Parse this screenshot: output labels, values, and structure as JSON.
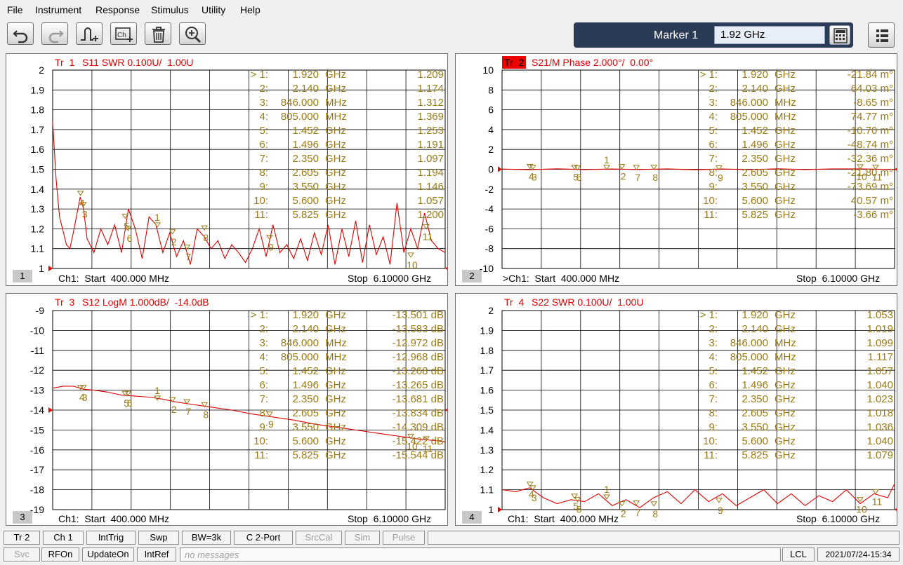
{
  "menu": [
    "File",
    "Instrument",
    "Response",
    "Stimulus",
    "Utility",
    "Help"
  ],
  "toolbar": {
    "buttons": [
      "undo-icon",
      "redo-icon",
      "add-marker-icon",
      "add-channel-icon",
      "delete-icon",
      "zoom-icon"
    ],
    "marker_label": "Marker 1",
    "marker_value": "1.92 GHz"
  },
  "colors": {
    "trace": "#e00000",
    "marker": "#9a7b18",
    "accent": "#2b3a55",
    "active_trace_box": "#ee0000"
  },
  "marker_freqs": {
    "values": [
      "1.920",
      "2.140",
      "846.000",
      "805.000",
      "1.452",
      "1.496",
      "2.350",
      "2.605",
      "3.550",
      "5.600",
      "5.825"
    ],
    "units": [
      "GHz",
      "GHz",
      "MHz",
      "MHz",
      "GHz",
      "GHz",
      "GHz",
      "GHz",
      "GHz",
      "GHz",
      "GHz"
    ]
  },
  "panels": [
    {
      "num": "1",
      "tr_label": "Tr  1",
      "title": "S11 SWR 0.100U/  1.00U",
      "footer_left": "Ch1:  Start  400.000 MHz",
      "footer_right": "Stop  6.10000 GHz",
      "marker_values": [
        "1.209",
        "1.174",
        "1.312",
        "1.369",
        "1.253",
        "1.191",
        "1.097",
        "1.194",
        "1.146",
        "1.057",
        "1.200"
      ],
      "chart_data": {
        "type": "line",
        "xlim": [
          0.4,
          6.1
        ],
        "ylim": [
          1.0,
          2.0
        ],
        "y_ticks": [
          "2",
          "1.9",
          "1.8",
          "1.7",
          "1.6",
          "1.5",
          "1.4",
          "1.3",
          "1.2",
          "1.1",
          "1"
        ],
        "series": [
          {
            "x": [
              0.4,
              0.45,
              0.5,
              0.6,
              0.65,
              0.7,
              0.8,
              0.85,
              0.9,
              1.0,
              1.1,
              1.2,
              1.3,
              1.4,
              1.5,
              1.6,
              1.7,
              1.8,
              1.9,
              2.0,
              2.1,
              2.2,
              2.3,
              2.4,
              2.5,
              2.6,
              2.7,
              2.8,
              2.9,
              3.0,
              3.1,
              3.2,
              3.3,
              3.4,
              3.5,
              3.6,
              3.7,
              3.8,
              3.9,
              4.0,
              4.1,
              4.2,
              4.3,
              4.4,
              4.5,
              4.6,
              4.7,
              4.8,
              4.9,
              5.0,
              5.1,
              5.2,
              5.3,
              5.4,
              5.5,
              5.6,
              5.7,
              5.8,
              5.9,
              6.0,
              6.1
            ],
            "y": [
              1.74,
              1.45,
              1.26,
              1.12,
              1.1,
              1.18,
              1.36,
              1.3,
              1.15,
              1.08,
              1.2,
              1.12,
              1.22,
              1.08,
              1.3,
              1.2,
              1.05,
              1.26,
              1.22,
              1.08,
              1.18,
              1.06,
              1.14,
              1.02,
              1.2,
              1.16,
              1.1,
              1.14,
              1.05,
              1.12,
              1.08,
              1.03,
              1.1,
              1.2,
              1.06,
              1.22,
              1.08,
              1.12,
              1.05,
              1.15,
              1.04,
              1.18,
              1.07,
              1.22,
              1.02,
              1.2,
              1.06,
              1.24,
              1.03,
              1.22,
              1.07,
              1.16,
              1.02,
              1.33,
              1.08,
              1.2,
              1.1,
              1.28,
              1.14,
              1.1,
              1.08
            ]
          }
        ]
      },
      "markers": [
        {
          "id": "1",
          "x": 1.92,
          "y": 1.209
        },
        {
          "id": "2",
          "x": 2.14,
          "y": 1.174
        },
        {
          "id": "3",
          "x": 0.846,
          "y": 1.312
        },
        {
          "id": "4",
          "x": 0.805,
          "y": 1.369
        },
        {
          "id": "5",
          "x": 1.452,
          "y": 1.253
        },
        {
          "id": "6",
          "x": 1.496,
          "y": 1.191
        },
        {
          "id": "7",
          "x": 2.35,
          "y": 1.097
        },
        {
          "id": "8",
          "x": 2.605,
          "y": 1.194
        },
        {
          "id": "9",
          "x": 3.55,
          "y": 1.146
        },
        {
          "id": "10",
          "x": 5.6,
          "y": 1.057
        },
        {
          "id": "11",
          "x": 5.825,
          "y": 1.2
        }
      ]
    },
    {
      "num": "2",
      "tr_label": "Tr  2",
      "title": "S21/M Phase 2.000°/  0.00°",
      "footer_left": ">Ch1:  Start  400.000 MHz",
      "footer_right": "Stop  6.10000 GHz",
      "marker_values": [
        "-21.84 m°",
        "64.03 m°",
        "-8.65 m°",
        "74.77 m°",
        "-10.70 m°",
        "-48.74 m°",
        "-32.36 m°",
        "-21.80 m°",
        "-73.69 m°",
        "40.57 m°",
        "-3.66 m°"
      ],
      "chart_data": {
        "type": "line",
        "xlim": [
          0.4,
          6.1
        ],
        "ylim": [
          -10,
          10
        ],
        "y_ticks": [
          "10",
          "8",
          "6",
          "4",
          "2",
          "0",
          "-2",
          "-4",
          "-6",
          "-8",
          "-10"
        ],
        "series": [
          {
            "x": [
              0.4,
              0.8,
              1.2,
              1.6,
              2.0,
              2.4,
              2.8,
              3.2,
              3.6,
              4.0,
              4.4,
              4.8,
              5.2,
              5.6,
              6.1
            ],
            "y": [
              0.02,
              -0.04,
              0.05,
              -0.03,
              0.03,
              -0.02,
              0.04,
              -0.05,
              0.03,
              -0.04,
              0.05,
              -0.03,
              0.04,
              0.04,
              -0.02
            ]
          }
        ]
      },
      "markers": [
        {
          "id": "1",
          "x": 1.92,
          "y": -0.02
        },
        {
          "id": "2",
          "x": 2.14,
          "y": 0.06
        },
        {
          "id": "3",
          "x": 0.846,
          "y": -0.01
        },
        {
          "id": "4",
          "x": 0.805,
          "y": 0.07
        },
        {
          "id": "5",
          "x": 1.452,
          "y": -0.01
        },
        {
          "id": "6",
          "x": 1.496,
          "y": -0.05
        },
        {
          "id": "7",
          "x": 2.35,
          "y": -0.03
        },
        {
          "id": "8",
          "x": 2.605,
          "y": -0.02
        },
        {
          "id": "9",
          "x": 3.55,
          "y": -0.07
        },
        {
          "id": "10",
          "x": 5.6,
          "y": 0.04
        },
        {
          "id": "11",
          "x": 5.825,
          "y": 0.0
        }
      ]
    },
    {
      "num": "3",
      "tr_label": "Tr  3",
      "title": "S12 LogM 1.000dB/  -14.0dB",
      "footer_left": "Ch1:  Start  400.000 MHz",
      "footer_right": "Stop  6.10000 GHz",
      "marker_values": [
        "-13.501 dB",
        "-13.583 dB",
        "-12.972 dB",
        "-12.968 dB",
        "-13.268 dB",
        "-13.265 dB",
        "-13.681 dB",
        "-13.834 dB",
        "-14.309 dB",
        "-15.422 dB",
        "-15.544 dB"
      ],
      "chart_data": {
        "type": "line",
        "xlim": [
          0.4,
          6.1
        ],
        "ylim": [
          -19,
          -9
        ],
        "y_ticks": [
          "-9",
          "-10",
          "-11",
          "-12",
          "-13",
          "-14",
          "-15",
          "-16",
          "-17",
          "-18",
          "-19"
        ],
        "series": [
          {
            "x": [
              0.4,
              0.55,
              0.7,
              0.85,
              1.0,
              1.2,
              1.4,
              1.6,
              1.8,
              2.0,
              2.2,
              2.4,
              2.6,
              2.8,
              3.0,
              3.3,
              3.6,
              3.9,
              4.2,
              4.5,
              4.8,
              5.1,
              5.4,
              5.7,
              6.0,
              6.1
            ],
            "y": [
              -12.9,
              -12.8,
              -12.8,
              -12.95,
              -13.0,
              -13.1,
              -13.25,
              -13.3,
              -13.35,
              -13.45,
              -13.6,
              -13.7,
              -13.8,
              -13.9,
              -14.0,
              -14.2,
              -14.35,
              -14.5,
              -14.7,
              -14.85,
              -15.0,
              -15.15,
              -15.3,
              -15.45,
              -15.55,
              -15.6
            ]
          }
        ]
      },
      "markers": [
        {
          "id": "1",
          "x": 1.92,
          "y": -13.501
        },
        {
          "id": "2",
          "x": 2.14,
          "y": -13.583
        },
        {
          "id": "3",
          "x": 0.846,
          "y": -12.972
        },
        {
          "id": "4",
          "x": 0.805,
          "y": -12.968
        },
        {
          "id": "5",
          "x": 1.452,
          "y": -13.268
        },
        {
          "id": "6",
          "x": 1.496,
          "y": -13.265
        },
        {
          "id": "7",
          "x": 2.35,
          "y": -13.681
        },
        {
          "id": "8",
          "x": 2.605,
          "y": -13.834
        },
        {
          "id": "9",
          "x": 3.55,
          "y": -14.309
        },
        {
          "id": "10",
          "x": 5.6,
          "y": -15.422
        },
        {
          "id": "11",
          "x": 5.825,
          "y": -15.544
        }
      ]
    },
    {
      "num": "4",
      "tr_label": "Tr  4",
      "title": "S22 SWR 0.100U/  1.00U",
      "footer_left": "Ch1:  Start  400.000 MHz",
      "footer_right": "Stop  6.10000 GHz",
      "marker_values": [
        "1.053",
        "1.019",
        "1.099",
        "1.117",
        "1.057",
        "1.040",
        "1.023",
        "1.018",
        "1.036",
        "1.040",
        "1.079"
      ],
      "chart_data": {
        "type": "line",
        "xlim": [
          0.4,
          6.1
        ],
        "ylim": [
          1.0,
          2.0
        ],
        "y_ticks": [
          "2",
          "1.9",
          "1.8",
          "1.7",
          "1.6",
          "1.5",
          "1.4",
          "1.3",
          "1.2",
          "1.1",
          "1"
        ],
        "series": [
          {
            "x": [
              0.4,
              0.6,
              0.8,
              1.0,
              1.2,
              1.4,
              1.6,
              1.8,
              2.0,
              2.2,
              2.4,
              2.6,
              2.8,
              3.0,
              3.2,
              3.4,
              3.6,
              3.8,
              4.0,
              4.2,
              4.4,
              4.6,
              4.8,
              5.0,
              5.2,
              5.4,
              5.6,
              5.8,
              6.0,
              6.1
            ],
            "y": [
              1.1,
              1.09,
              1.11,
              1.06,
              1.03,
              1.05,
              1.04,
              1.08,
              1.02,
              1.05,
              1.01,
              1.06,
              1.09,
              1.03,
              1.1,
              1.04,
              1.08,
              1.02,
              1.06,
              1.1,
              1.03,
              1.08,
              1.02,
              1.07,
              1.04,
              1.1,
              1.03,
              1.08,
              1.06,
              1.13
            ]
          }
        ]
      },
      "markers": [
        {
          "id": "1",
          "x": 1.92,
          "y": 1.053
        },
        {
          "id": "2",
          "x": 2.14,
          "y": 1.019
        },
        {
          "id": "3",
          "x": 0.846,
          "y": 1.099
        },
        {
          "id": "4",
          "x": 0.805,
          "y": 1.117
        },
        {
          "id": "5",
          "x": 1.452,
          "y": 1.057
        },
        {
          "id": "6",
          "x": 1.496,
          "y": 1.04
        },
        {
          "id": "7",
          "x": 2.35,
          "y": 1.023
        },
        {
          "id": "8",
          "x": 2.605,
          "y": 1.018
        },
        {
          "id": "9",
          "x": 3.55,
          "y": 1.036
        },
        {
          "id": "10",
          "x": 5.6,
          "y": 1.04
        },
        {
          "id": "11",
          "x": 5.825,
          "y": 1.079
        }
      ]
    }
  ],
  "status_row1": [
    {
      "label": "Tr 2",
      "enabled": true
    },
    {
      "label": "Ch 1",
      "enabled": true
    },
    {
      "label": "IntTrig",
      "enabled": true
    },
    {
      "label": "Swp",
      "enabled": true
    },
    {
      "label": "BW=3k",
      "enabled": true
    },
    {
      "label": "C  2-Port",
      "enabled": true
    },
    {
      "label": "SrcCal",
      "enabled": false
    },
    {
      "label": "Sim",
      "enabled": false
    },
    {
      "label": "Pulse",
      "enabled": false
    }
  ],
  "status_row2": [
    {
      "label": "Svc",
      "enabled": false
    },
    {
      "label": "RFOn",
      "enabled": true
    },
    {
      "label": "UpdateOn",
      "enabled": true
    },
    {
      "label": "IntRef",
      "enabled": true
    }
  ],
  "messages": "no messages",
  "lcl": "LCL",
  "datetime": "2021/07/24-15:34"
}
